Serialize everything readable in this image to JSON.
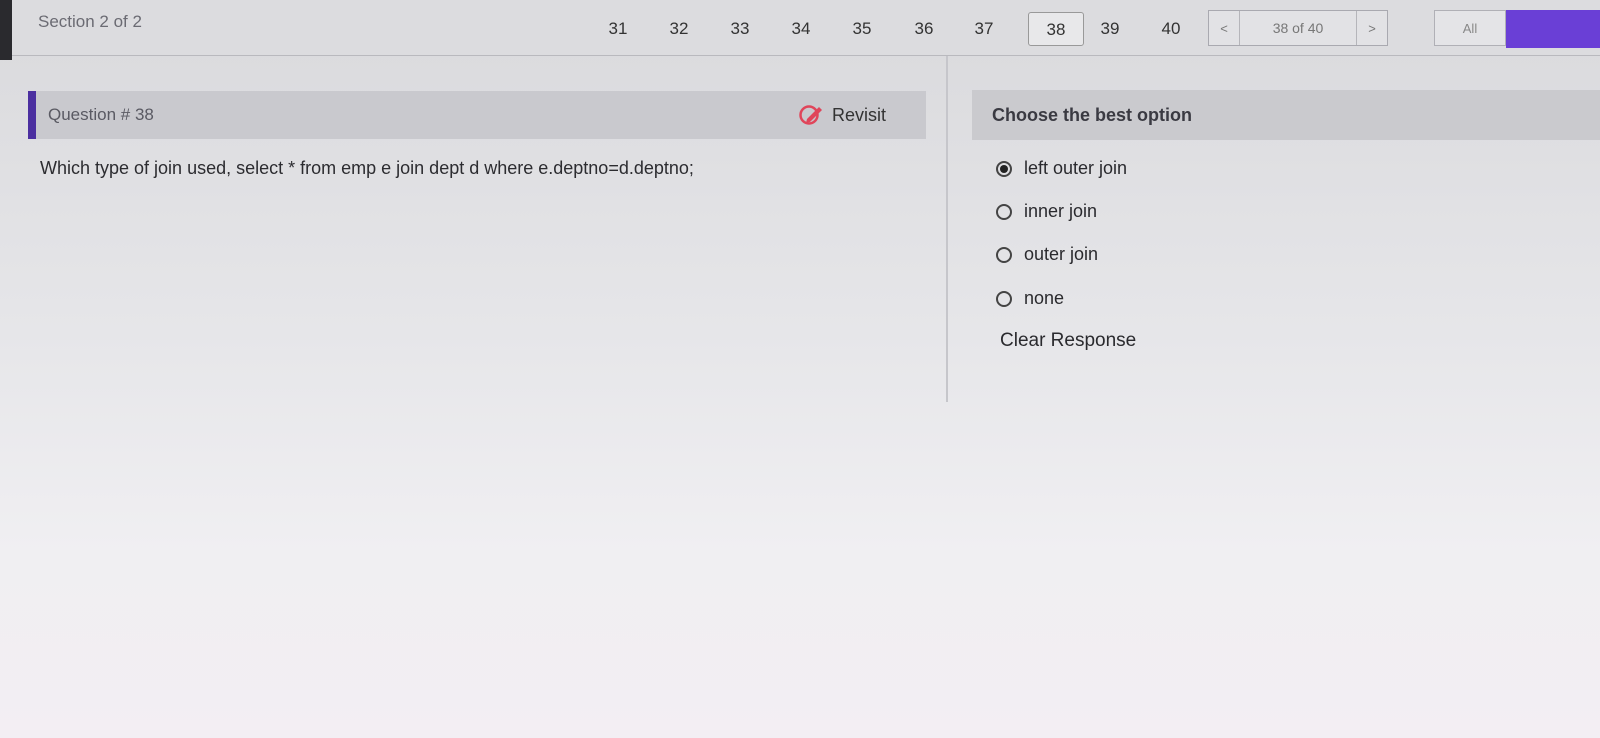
{
  "header": {
    "section_label": "Section 2 of 2",
    "question_numbers": [
      "31",
      "32",
      "33",
      "34",
      "35",
      "36",
      "37",
      "38",
      "39",
      "40"
    ],
    "active_question": "38",
    "pager_prev": "<",
    "pager_status": "38 of 40",
    "pager_next": ">",
    "all_label": "All"
  },
  "question": {
    "title": "Question # 38",
    "revisit_label": "Revisit",
    "text": "Which type of join used, select * from emp e join dept d where e.deptno=d.deptno;"
  },
  "answers": {
    "heading": "Choose the best option",
    "options": [
      {
        "label": "left outer join",
        "selected": true
      },
      {
        "label": "inner join",
        "selected": false
      },
      {
        "label": "outer join",
        "selected": false
      },
      {
        "label": "none",
        "selected": false
      }
    ],
    "clear_label": "Clear Response"
  },
  "colors": {
    "accent": "#4b2fa0",
    "purple_bar": "#6a3fd6",
    "revisit_icon": "#e0455a"
  },
  "icons": {
    "revisit": "edit-pencil-icon",
    "radio_selected": "radio-checked-icon",
    "radio_unselected": "radio-unchecked-icon"
  }
}
